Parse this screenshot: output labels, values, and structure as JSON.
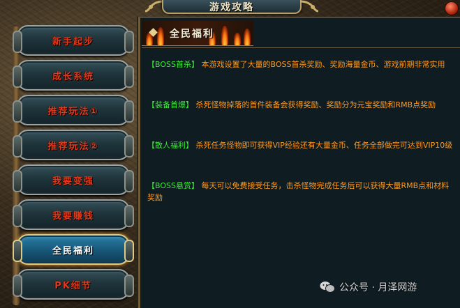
{
  "window": {
    "title": "游戏攻略",
    "close_icon": "close-icon"
  },
  "sidebar": {
    "items": [
      {
        "label": "新手起步",
        "active": false
      },
      {
        "label": "成长系统",
        "active": false
      },
      {
        "label": "推荐玩法①",
        "active": false
      },
      {
        "label": "推荐玩法②",
        "active": false
      },
      {
        "label": "我要变强",
        "active": false
      },
      {
        "label": "我要赚钱",
        "active": false
      },
      {
        "label": "全民福利",
        "active": true
      },
      {
        "label": "PK细节",
        "active": false
      }
    ]
  },
  "content": {
    "header": "全民福利",
    "entries": [
      {
        "tag": "【BOSS首杀】",
        "text": "本游戏设置了大量的BOSS首杀奖励、奖励海量金币、游戏前期非常实用"
      },
      {
        "tag": "【装备首爆】",
        "text": "杀死怪物掉落的首件装备会获得奖励、奖励分为元宝奖励和RMB点奖励"
      },
      {
        "tag": "【散人福利】",
        "text": "杀死任务怪物即可获得VIP经验还有大量金币、任务全部做完可达到VIP10级"
      },
      {
        "tag": "【BOSS悬赏】",
        "text": "每天可以免费接受任务，击杀怪物完成任务后可以获得大量RMB点和材料奖励"
      }
    ]
  },
  "watermark": {
    "text": "公众号 · 月泽网游",
    "icon": "wechat-icon"
  },
  "colors": {
    "tag_green": "#3ee83a",
    "body_orange": "#ff9a1e",
    "tab_label_red": "#e03a1c",
    "active_tab_blue": "#1a5d80"
  }
}
